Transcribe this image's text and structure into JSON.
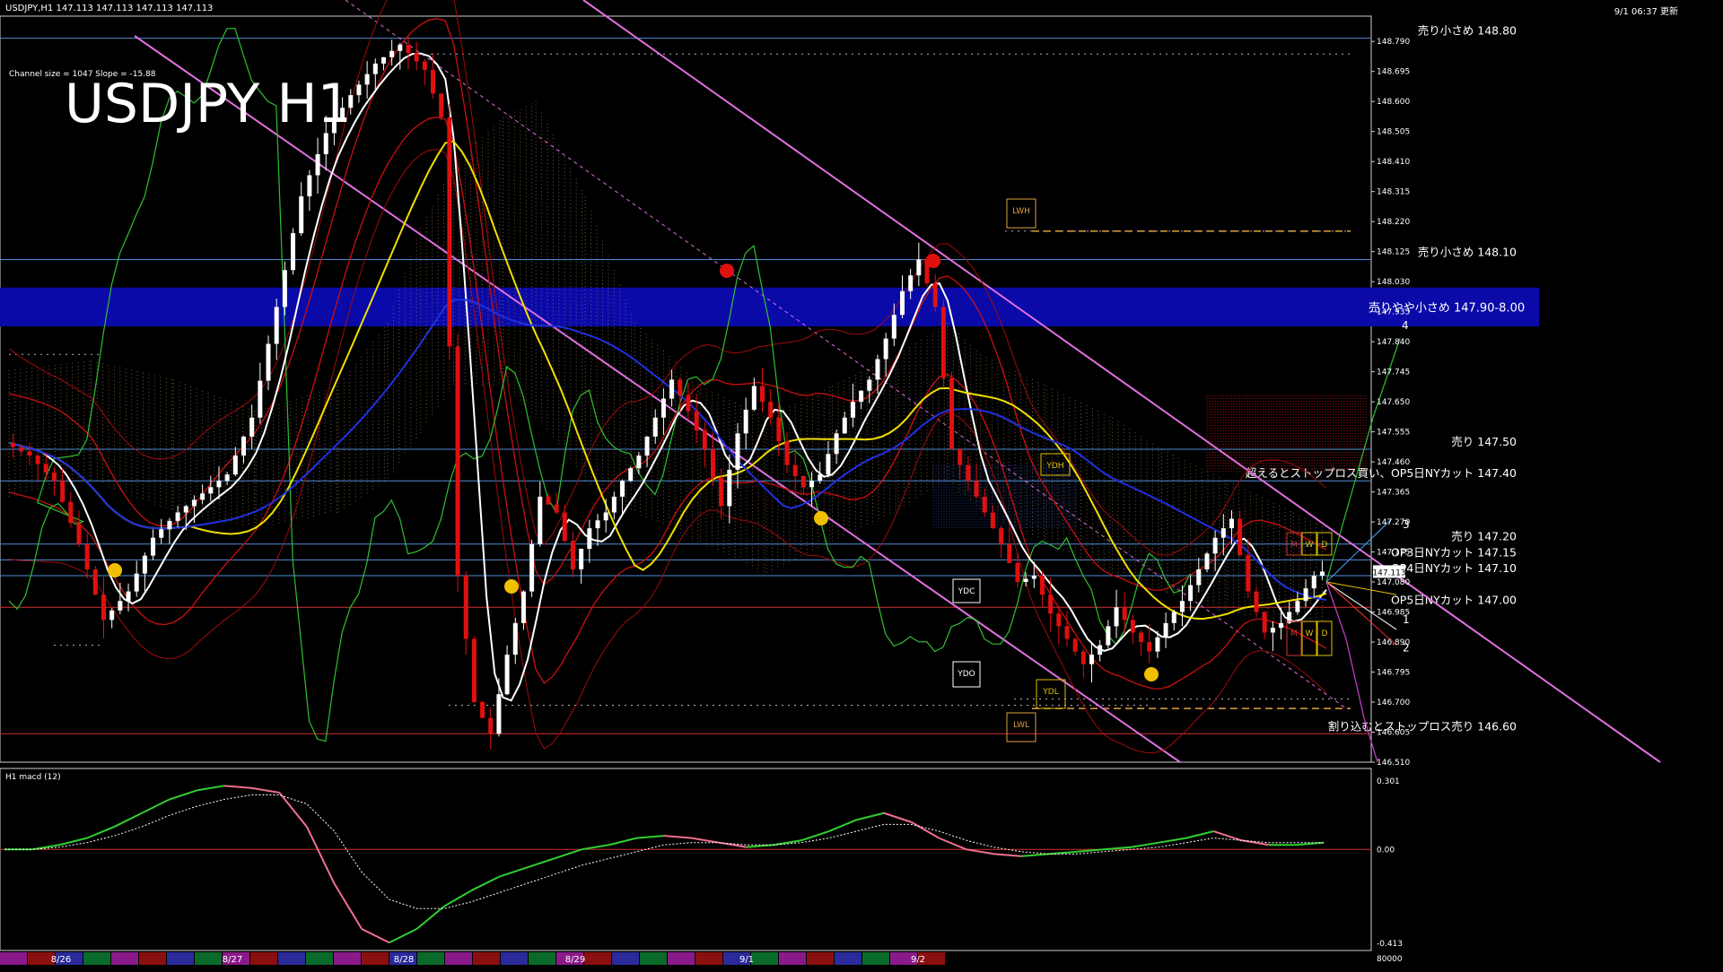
{
  "header": {
    "symbol_line": "USDJPY,H1  147.113 147.113 147.113 147.113",
    "updated": "9/1 06:37 更新",
    "channel_info": "Channel size = 1047 Slope = -15.88",
    "big_title": "USDJPY H1"
  },
  "chart_data": [
    {
      "type": "line",
      "symbol": "USDJPY",
      "timeframe": "H1",
      "current_price": "147.113",
      "ylim": [
        146.51,
        148.87
      ],
      "y_ticks": [
        "148.790",
        "148.695",
        "148.600",
        "148.505",
        "148.410",
        "148.315",
        "148.220",
        "148.125",
        "148.030",
        "147.935",
        "147.840",
        "147.745",
        "147.650",
        "147.555",
        "147.460",
        "147.365",
        "147.270",
        "147.175",
        "147.080",
        "146.985",
        "146.890",
        "146.795",
        "146.700",
        "146.605",
        "146.510"
      ],
      "date_labels": [
        "8/26",
        "8/27",
        "8/28",
        "8/29",
        "9/1",
        "9/2"
      ],
      "close_series": [
        {
          "t": 0,
          "p": 147.52
        },
        {
          "t": 3,
          "p": 147.48
        },
        {
          "t": 6,
          "p": 147.4
        },
        {
          "t": 9,
          "p": 147.2
        },
        {
          "t": 12,
          "p": 146.96
        },
        {
          "t": 15,
          "p": 147.05
        },
        {
          "t": 18,
          "p": 147.22
        },
        {
          "t": 21,
          "p": 147.3
        },
        {
          "t": 24,
          "p": 147.36
        },
        {
          "t": 27,
          "p": 147.42
        },
        {
          "t": 30,
          "p": 147.6
        },
        {
          "t": 33,
          "p": 147.95
        },
        {
          "t": 36,
          "p": 148.3
        },
        {
          "t": 39,
          "p": 148.5
        },
        {
          "t": 42,
          "p": 148.62
        },
        {
          "t": 45,
          "p": 148.72
        },
        {
          "t": 48,
          "p": 148.78
        },
        {
          "t": 51,
          "p": 148.7
        },
        {
          "t": 53,
          "p": 148.55
        },
        {
          "t": 55,
          "p": 147.1
        },
        {
          "t": 57,
          "p": 146.7
        },
        {
          "t": 59,
          "p": 146.6
        },
        {
          "t": 61,
          "p": 146.85
        },
        {
          "t": 63,
          "p": 147.05
        },
        {
          "t": 65,
          "p": 147.35
        },
        {
          "t": 67,
          "p": 147.3
        },
        {
          "t": 69,
          "p": 147.12
        },
        {
          "t": 71,
          "p": 147.25
        },
        {
          "t": 73,
          "p": 147.3
        },
        {
          "t": 75,
          "p": 147.4
        },
        {
          "t": 77,
          "p": 147.48
        },
        {
          "t": 79,
          "p": 147.6
        },
        {
          "t": 81,
          "p": 147.72
        },
        {
          "t": 83,
          "p": 147.62
        },
        {
          "t": 85,
          "p": 147.5
        },
        {
          "t": 87,
          "p": 147.32
        },
        {
          "t": 89,
          "p": 147.55
        },
        {
          "t": 91,
          "p": 147.7
        },
        {
          "t": 93,
          "p": 147.6
        },
        {
          "t": 95,
          "p": 147.45
        },
        {
          "t": 97,
          "p": 147.38
        },
        {
          "t": 99,
          "p": 147.42
        },
        {
          "t": 101,
          "p": 147.55
        },
        {
          "t": 103,
          "p": 147.65
        },
        {
          "t": 105,
          "p": 147.72
        },
        {
          "t": 107,
          "p": 147.85
        },
        {
          "t": 109,
          "p": 148.0
        },
        {
          "t": 111,
          "p": 148.1
        },
        {
          "t": 113,
          "p": 147.95
        },
        {
          "t": 115,
          "p": 147.5
        },
        {
          "t": 117,
          "p": 147.4
        },
        {
          "t": 119,
          "p": 147.3
        },
        {
          "t": 121,
          "p": 147.2
        },
        {
          "t": 123,
          "p": 147.08
        },
        {
          "t": 125,
          "p": 147.1
        },
        {
          "t": 127,
          "p": 146.98
        },
        {
          "t": 129,
          "p": 146.9
        },
        {
          "t": 131,
          "p": 146.82
        },
        {
          "t": 133,
          "p": 146.88
        },
        {
          "t": 135,
          "p": 147.0
        },
        {
          "t": 137,
          "p": 146.92
        },
        {
          "t": 139,
          "p": 146.86
        },
        {
          "t": 141,
          "p": 146.95
        },
        {
          "t": 143,
          "p": 147.02
        },
        {
          "t": 145,
          "p": 147.12
        },
        {
          "t": 147,
          "p": 147.22
        },
        {
          "t": 149,
          "p": 147.28
        },
        {
          "t": 151,
          "p": 147.05
        },
        {
          "t": 153,
          "p": 146.92
        },
        {
          "t": 155,
          "p": 146.95
        },
        {
          "t": 157,
          "p": 147.02
        },
        {
          "t": 159,
          "p": 147.1
        },
        {
          "t": 160,
          "p": 147.113
        }
      ],
      "horizontal_levels": [
        {
          "label": "売り小さめ 148.80",
          "price": 148.8,
          "color": "#4f8cd6"
        },
        {
          "label": "売り小さめ 148.10",
          "price": 148.1,
          "color": "#4f8cd6"
        },
        {
          "label": "売り 147.50",
          "price": 147.5,
          "color": "#4f8cd6"
        },
        {
          "label": "超えるとストップロス買い、OP5日NYカット 147.40",
          "price": 147.4,
          "color": "#4f8cd6"
        },
        {
          "label": "売り 147.20",
          "price": 147.2,
          "color": "#4f8cd6"
        },
        {
          "label": "OP3日NYカット 147.15",
          "price": 147.15,
          "color": "#4f8cd6"
        },
        {
          "label": "OP4日NYカット 147.10",
          "price": 147.1,
          "color": "#4f8cd6"
        },
        {
          "label": "OP5日NYカット 147.00",
          "price": 147.0,
          "color": "#d23232"
        },
        {
          "label": "割り込むとストップロス売り 146.60",
          "price": 146.6,
          "color": "#d23232"
        }
      ],
      "zone": {
        "label": "売りやや小さめ 147.90-8.00",
        "low": 147.9,
        "high": 148.0,
        "color": "#0a0aa8"
      },
      "marker_labels": [
        "LWH",
        "YDH",
        "YDC",
        "YDO",
        "YDL",
        "LWL",
        "M",
        "W",
        "D",
        "M",
        "W",
        "D"
      ],
      "projection_labels": [
        "1",
        "2",
        "3",
        "4"
      ]
    },
    {
      "type": "line",
      "title": "H1  macd (12)",
      "ylim": [
        -0.413,
        0.301
      ],
      "y_ticks": [
        "0.301",
        "0.00",
        "-0.413"
      ],
      "bottom_label": "80000",
      "macd_series": [
        0.0,
        0.0,
        0.02,
        0.05,
        0.1,
        0.16,
        0.22,
        0.26,
        0.28,
        0.27,
        0.25,
        0.1,
        -0.15,
        -0.35,
        -0.41,
        -0.35,
        -0.25,
        -0.18,
        -0.12,
        -0.08,
        -0.04,
        0.0,
        0.02,
        0.05,
        0.06,
        0.05,
        0.03,
        0.01,
        0.02,
        0.04,
        0.08,
        0.13,
        0.16,
        0.12,
        0.05,
        0.0,
        -0.02,
        -0.03,
        -0.02,
        -0.01,
        0.0,
        0.01,
        0.03,
        0.05,
        0.08,
        0.04,
        0.02,
        0.02,
        0.03
      ],
      "signal_series": [
        0.0,
        0.0,
        0.01,
        0.03,
        0.06,
        0.1,
        0.15,
        0.19,
        0.22,
        0.24,
        0.24,
        0.2,
        0.08,
        -0.1,
        -0.22,
        -0.26,
        -0.26,
        -0.23,
        -0.19,
        -0.15,
        -0.11,
        -0.07,
        -0.04,
        -0.01,
        0.02,
        0.03,
        0.03,
        0.02,
        0.02,
        0.03,
        0.05,
        0.08,
        0.11,
        0.11,
        0.08,
        0.04,
        0.01,
        -0.01,
        -0.02,
        -0.02,
        -0.01,
        0.0,
        0.01,
        0.03,
        0.05,
        0.04,
        0.03,
        0.03,
        0.03
      ]
    }
  ],
  "colors": {
    "background": "#000000",
    "bull": "#ffffff",
    "bear": "#e01010",
    "ma_white": "#ffffff",
    "ma_yellow": "#f0e000",
    "ma_blue": "#2030e0",
    "band_red": "#cc1010",
    "green_line": "#30c030",
    "channel": "#e070e0",
    "grid_border": "#d0d0d0"
  }
}
